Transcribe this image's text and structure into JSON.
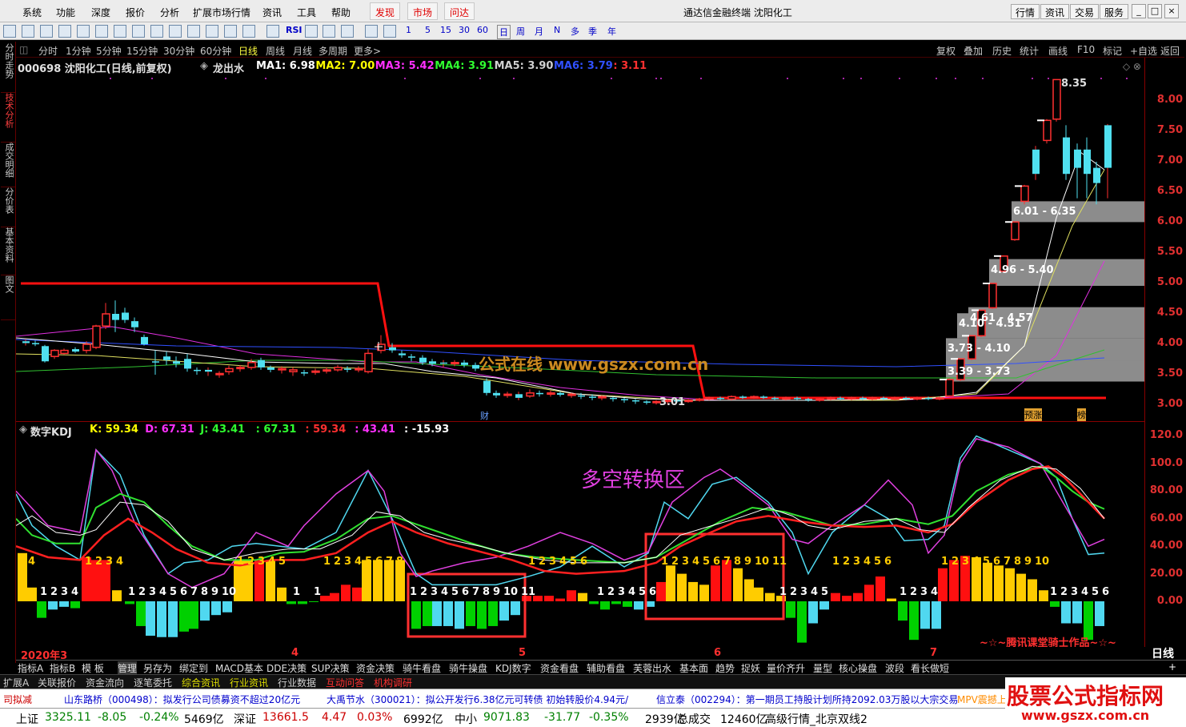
{
  "menu": {
    "items": [
      "系统",
      "功能",
      "深度",
      "报价",
      "分析",
      "扩展市场行情",
      "资讯",
      "工具",
      "帮助"
    ],
    "hot": [
      "发现",
      "市场",
      "问达"
    ],
    "title": "通达信金融终端  沈阳化工",
    "right_buttons": [
      "行情",
      "资讯",
      "交易",
      "服务"
    ],
    "win_controls": [
      "_",
      "□",
      "×"
    ]
  },
  "toolbar": {
    "numbers": [
      "1",
      "5",
      "15",
      "30",
      "60"
    ],
    "periods": [
      "日",
      "周",
      "月",
      "N",
      "多",
      "季",
      "年"
    ],
    "rsi_label": "RSI"
  },
  "leftnav": {
    "tabs": [
      "分时走势",
      "技术分析",
      "成交明细",
      "分价表",
      "基本资料",
      "图文F10"
    ],
    "active": 1
  },
  "periodbar": {
    "items": [
      "分时",
      "1分钟",
      "5分钟",
      "15分钟",
      "30分钟",
      "60分钟",
      "日线",
      "周线",
      "月线",
      "多周期",
      "更多>"
    ],
    "active": 6,
    "right": [
      "复权",
      "叠加",
      "历史",
      "统计",
      "画线",
      "F10",
      "标记",
      "+自选",
      "返回"
    ]
  },
  "main": {
    "stock_title": "000698 沈阳化工(日线,前复权)",
    "indicator": "龙出水",
    "ma": [
      {
        "label": "MA1: 6.98",
        "color": "#ffffff"
      },
      {
        "label": "MA2: 7.00",
        "color": "#ffff00"
      },
      {
        "label": "MA3: 5.42",
        "color": "#ff30ff"
      },
      {
        "label": "MA4: 3.91",
        "color": "#30ff30"
      },
      {
        "label": "MA5: 3.90",
        "color": "#d0d0d0"
      },
      {
        "label": "MA6: 3.79",
        "color": "#3050ff"
      },
      {
        "label": ": 3.11",
        "color": "#ff3030"
      }
    ],
    "watermark": "公式在线 www.gszx.com.cn",
    "high_label": "8.35",
    "low_label": "3.01",
    "fin_marker": "财",
    "markers": [
      "预涨",
      "榜"
    ],
    "zones": [
      "6.01 - 6.35",
      "4.96 - 5.40",
      "4.61 - 4.57",
      "4.10 - 4.51",
      "3.73 - 4.10",
      "3.39 - 3.73"
    ]
  },
  "kdj": {
    "title": "数字KDJ",
    "legend": [
      {
        "label": "K: 59.34",
        "color": "#ffff00"
      },
      {
        "label": "D: 67.31",
        "color": "#ff30ff"
      },
      {
        "label": "J: 43.41",
        "color": "#30ff30"
      },
      {
        "label": ": 67.31",
        "color": "#30ff30"
      },
      {
        "label": ": 59.34",
        "color": "#ff3030"
      },
      {
        "label": ": 43.41",
        "color": "#ff30ff"
      },
      {
        "label": ": -15.93",
        "color": "#ffffff"
      }
    ],
    "annotation": "多空转换区",
    "signature": "~☆~腾讯课堂骑士作品~☆~"
  },
  "axis": {
    "main": [
      "8.00",
      "7.50",
      "7.00",
      "6.50",
      "6.00",
      "5.50",
      "5.00",
      "4.50",
      "4.00",
      "3.50",
      "3.00"
    ],
    "kdj": [
      "120.0",
      "100.0",
      "80.00",
      "60.00",
      "40.00",
      "20.00",
      "0.00"
    ],
    "period_label": "日线"
  },
  "datebar": {
    "labels": [
      "2020年3",
      "4",
      "5",
      "6",
      "7"
    ]
  },
  "tabsA": {
    "items": [
      "指标A",
      "指标B",
      "模 板",
      "管理",
      "另存为",
      "绑定到",
      "MACD基本",
      "DDE决策",
      "SUP决策",
      "资金决策",
      "骑牛看盘",
      "骑牛操盘",
      "KDJ数字",
      "资金看盘",
      "辅助看盘",
      "芙蓉出水",
      "基本面",
      "趋势",
      "捉妖",
      "量价齐升",
      "量型",
      "核心操盘",
      "波段",
      "看长做短"
    ],
    "active": 3
  },
  "tabsB": {
    "items": [
      "扩展A",
      "关联报价",
      "资金流向",
      "逐笔委托",
      "综合资讯",
      "行业资讯",
      "行业数据",
      "互动问答",
      "机构调研"
    ],
    "hl": [
      4,
      5
    ]
  },
  "news": {
    "items": [
      {
        "text": "司拟减",
        "color": "#cc0000"
      },
      {
        "text": "山东路桥（000498）：拟发行公司债募资不超过20亿元",
        "color": "#0000cc"
      },
      {
        "text": "大禹节水（300021）：拟公开发行6.38亿元可转债 初始转股价4.94元/",
        "color": "#0000cc"
      },
      {
        "text": "信立泰（002294）：第一期员工持股计划所持2092.03万股以大宗交易",
        "color": "#0000cc"
      },
      {
        "text": "MPV震撼上",
        "color": "#ff8c00"
      }
    ]
  },
  "status": {
    "items": [
      {
        "text": "上证",
        "color": "#000"
      },
      {
        "text": "3325.11",
        "color": "#008000"
      },
      {
        "text": "-8.05",
        "color": "#008000"
      },
      {
        "text": "-0.24%",
        "color": "#008000"
      },
      {
        "text": "5469亿",
        "color": "#000"
      },
      {
        "text": "深证",
        "color": "#000"
      },
      {
        "text": "13661.5",
        "color": "#cc0000"
      },
      {
        "text": "4.47",
        "color": "#cc0000"
      },
      {
        "text": "0.03%",
        "color": "#cc0000"
      },
      {
        "text": "6992亿",
        "color": "#000"
      },
      {
        "text": "中小",
        "color": "#000"
      },
      {
        "text": "9071.83",
        "color": "#008000"
      },
      {
        "text": "-31.77",
        "color": "#008000"
      },
      {
        "text": "-0.35%",
        "color": "#008000"
      },
      {
        "text": "2939亿",
        "color": "#000"
      },
      {
        "text": "总成交",
        "color": "#000"
      },
      {
        "text": "12460亿",
        "color": "#000"
      },
      {
        "text": "高级行情_北京双线2",
        "color": "#000"
      }
    ]
  },
  "brand": {
    "line1": "股票公式指标网",
    "line2": "www.gszx.com.cn"
  }
}
